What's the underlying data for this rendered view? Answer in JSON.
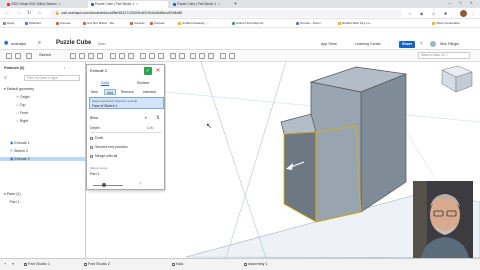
{
  "browser": {
    "tabs": [
      {
        "label": "2020 Virtual 2020 (Mini) Season",
        "active": false
      },
      {
        "label": "Puzzle Cube | Part Studio 1",
        "active": true
      },
      {
        "label": "Puzzle Cube | Part Studio 1",
        "active": false
      }
    ],
    "new_tab": "+",
    "url": "cad.onshape.com/documents/ca58e0f4217120009c501f1b2d4fd8ecc87e8d85",
    "bookmarks": [
      "Apps",
      "Whitelist",
      "Canvas",
      "Ace Bot Robot - Re...",
      "Canvas",
      "Canvas",
      "Untitled drawing -...",
      "Active Host Reports",
      "Heroku - Zoom",
      "Default Web Key Lo...",
      "Other bookmarks"
    ]
  },
  "onshape": {
    "logo": "onshape",
    "doc_title": "Puzzle Cube",
    "doc_branch": "Main",
    "app_store": "App Store",
    "learning_center": "Learning Center",
    "share": "Share",
    "user": "Nick Fllinger",
    "sketch": "Sketch",
    "search_tools_placeholder": "Search tools",
    "search_tools_hint": "alt C"
  },
  "features": {
    "header": "Features (6)",
    "filter_placeholder": "Filter by name or type",
    "items": [
      {
        "label": "Default geometry",
        "selected": false
      },
      {
        "label": "Origin",
        "selected": false
      },
      {
        "label": "Top",
        "selected": false
      },
      {
        "label": "Front",
        "selected": false
      },
      {
        "label": "Right",
        "selected": false
      },
      {
        "label": "Extrude 1",
        "selected": false
      },
      {
        "label": "Sketch 2",
        "selected": false
      },
      {
        "label": "Extrude 2",
        "selected": true
      }
    ],
    "parts_header": "Parts (1)",
    "parts": [
      "Part 1"
    ]
  },
  "dialog": {
    "title": "Extrude 2",
    "ok": "✓",
    "cancel": "✕",
    "type_tabs": [
      "Solid",
      "Surface"
    ],
    "mode_tabs": [
      "New",
      "Add",
      "Remove",
      "Intersect"
    ],
    "faces_label": "Faces and sketch regions to extrude",
    "faces_value": "Face of Sketch 1",
    "end_type": "Blind",
    "depth_label": "Depth",
    "depth_value": "1 in",
    "draft": "Draft",
    "second_end": "Second end position",
    "merge_all": "Merge with all",
    "merge_scope_label": "Merge scope",
    "merge_scope_value": "Part 1"
  },
  "bottom_tabs": [
    "Part Studio 1",
    "Part Studio 2",
    "Nick",
    "Assembly 1"
  ],
  "colors": {
    "accent": "#1864c2",
    "ok": "#2ea44f",
    "selected_row": "#bcd6f5",
    "part_face": "#8e9aa5"
  }
}
